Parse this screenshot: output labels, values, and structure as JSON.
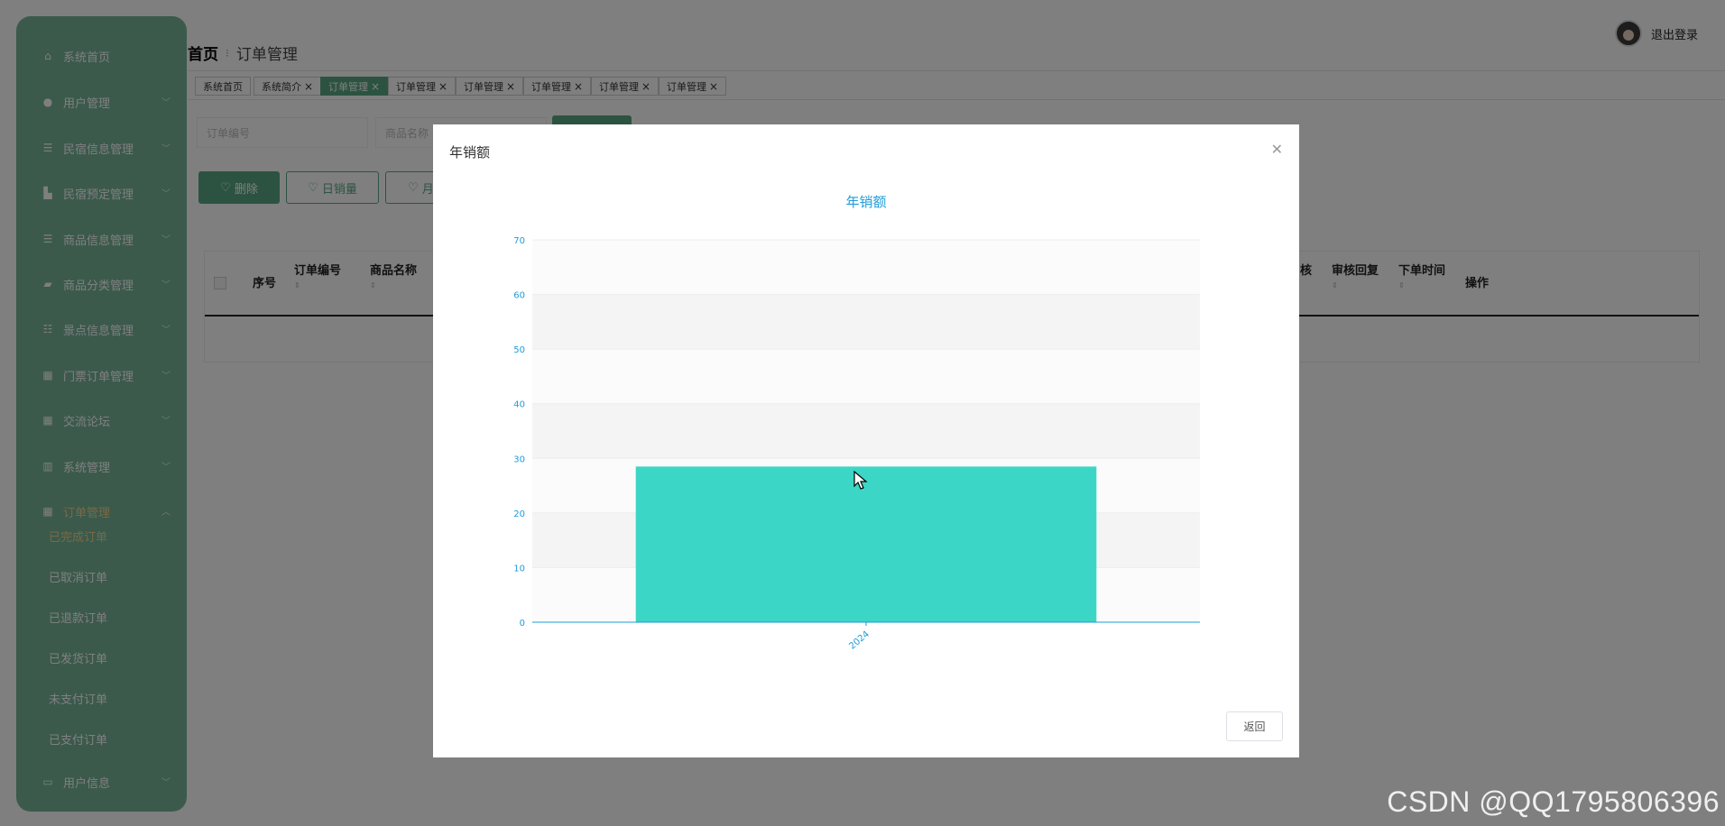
{
  "sidebar": {
    "items": [
      {
        "label": "系统首页",
        "icon": "home-icon"
      },
      {
        "label": "用户管理",
        "icon": "user-icon"
      },
      {
        "label": "民宿信息管理",
        "icon": "list-icon"
      },
      {
        "label": "民宿预定管理",
        "icon": "building-icon"
      },
      {
        "label": "商品信息管理",
        "icon": "list-icon"
      },
      {
        "label": "商品分类管理",
        "icon": "tag-icon"
      },
      {
        "label": "景点信息管理",
        "icon": "sliders-icon"
      },
      {
        "label": "门票订单管理",
        "icon": "grid-icon"
      },
      {
        "label": "交流论坛",
        "icon": "grid-icon"
      },
      {
        "label": "系统管理",
        "icon": "bar-chart-icon"
      },
      {
        "label": "订单管理",
        "icon": "grid-icon"
      }
    ],
    "sub_items": [
      {
        "label": "已完成订单"
      },
      {
        "label": "已取消订单"
      },
      {
        "label": "已退款订单"
      },
      {
        "label": "已发货订单"
      },
      {
        "label": "未支付订单"
      },
      {
        "label": "已支付订单"
      }
    ],
    "last_item": {
      "label": "用户信息",
      "icon": "card-icon"
    }
  },
  "header": {
    "breadcrumb_home": "首页",
    "breadcrumb_current": "订单管理",
    "logout": "退出登录"
  },
  "tabs": [
    {
      "label": "系统首页",
      "closable": false
    },
    {
      "label": "系统简介",
      "closable": true
    },
    {
      "label": "订单管理",
      "closable": true,
      "active": true
    },
    {
      "label": "订单管理",
      "closable": true
    },
    {
      "label": "订单管理",
      "closable": true
    },
    {
      "label": "订单管理",
      "closable": true
    },
    {
      "label": "订单管理",
      "closable": true
    },
    {
      "label": "订单管理",
      "closable": true
    }
  ],
  "search": {
    "order_no_placeholder": "订单编号",
    "product_name_placeholder": "商品名称"
  },
  "actions": {
    "delete": "删除",
    "daily_sales": "日销量",
    "monthly_partial": "月"
  },
  "table": {
    "columns": [
      "序号",
      "订单编号",
      "商品名称",
      "核",
      "审核回复",
      "下单时间",
      "操作"
    ]
  },
  "dialog": {
    "title": "年销额",
    "return_button": "返回"
  },
  "chart_data": {
    "type": "bar",
    "title": "年销额",
    "categories": [
      "2024"
    ],
    "values": [
      28.5
    ],
    "ylim": [
      0,
      70
    ],
    "yticks": [
      0,
      10,
      20,
      30,
      40,
      50,
      60,
      70
    ],
    "xlabel": "",
    "ylabel": "",
    "grid": true,
    "colors": {
      "bar": "#3bd6c6",
      "axis": "#1f9bd7",
      "title": "#1f9bd7"
    }
  },
  "watermark": "CSDN @QQ1795806396"
}
